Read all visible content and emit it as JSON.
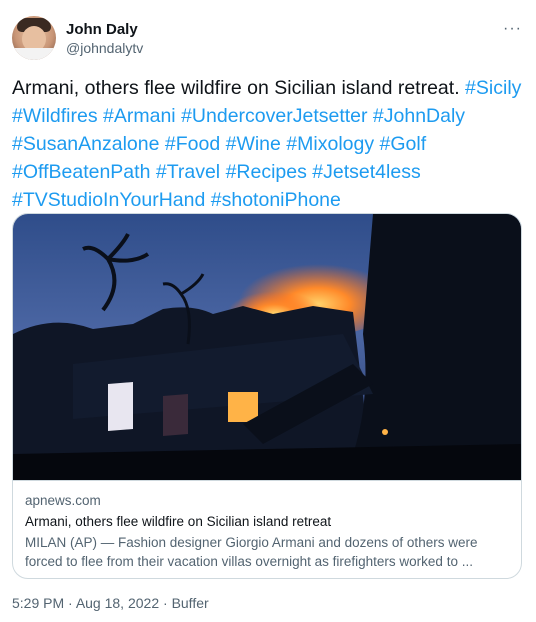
{
  "author": {
    "name": "John Daly",
    "handle": "@johndalytv"
  },
  "more_label": "···",
  "tweet": {
    "text": "Armani, others flee wildfire on Sicilian island retreat.",
    "hashtags": [
      "#Sicily",
      "#Wildfires",
      "#Armani",
      "#UndercoverJetsetter",
      "#JohnDaly",
      "#SusanAnzalone",
      "#Food",
      "#Wine",
      "#Mixology",
      "#Golf",
      "#OffBeatenPath",
      "#Travel",
      "#Recipes",
      "#Jetset4less",
      "#TVStudioInYourHand",
      "#shotoniPhone"
    ]
  },
  "card": {
    "domain": "apnews.com",
    "title": "Armani, others flee wildfire on Sicilian island retreat",
    "description": "MILAN (AP) — Fashion designer Giorgio Armani and dozens of others were forced to flee from their vacation villas overnight as firefighters worked to ..."
  },
  "meta": {
    "time": "5:29 PM",
    "separator1": " · ",
    "date": "Aug 18, 2022",
    "separator2": " · ",
    "source": "Buffer"
  },
  "colors": {
    "link": "#1d9bf0",
    "text": "#0f1419",
    "secondary": "#536471",
    "border": "#cfd9de"
  }
}
